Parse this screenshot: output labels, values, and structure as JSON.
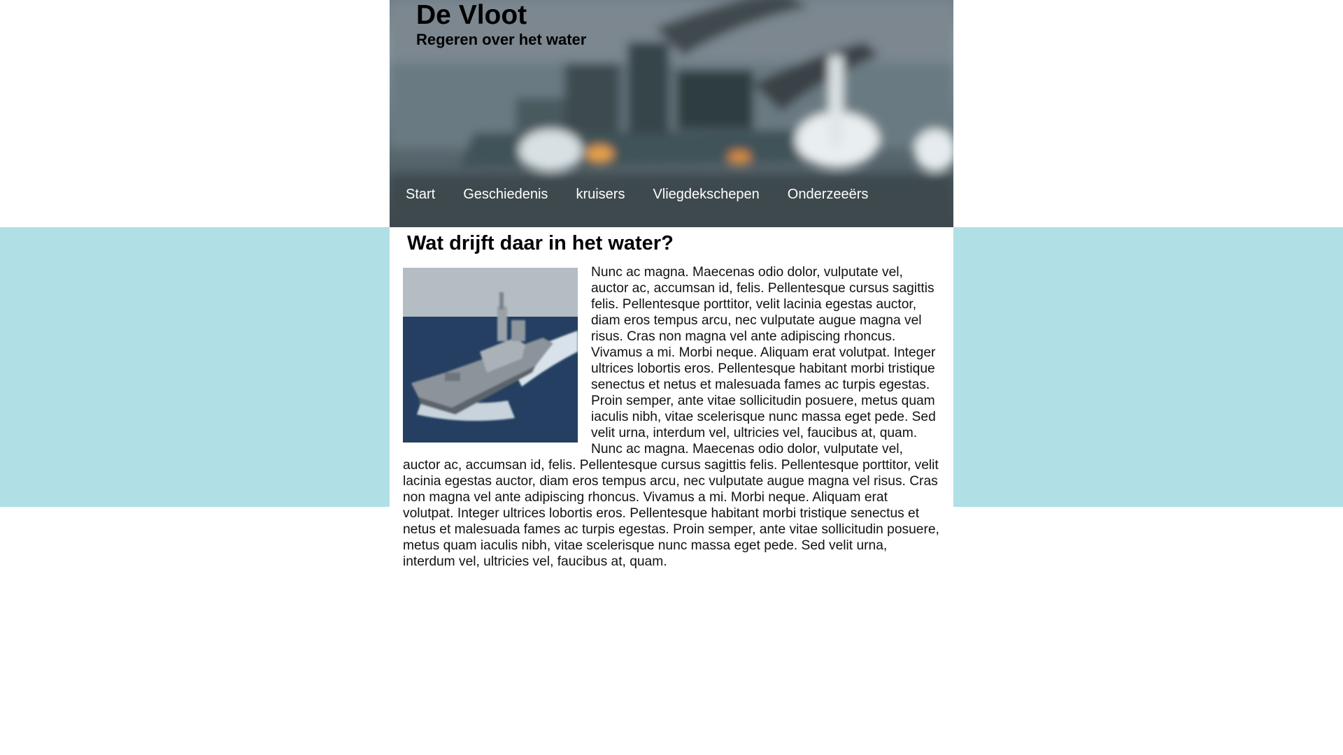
{
  "header": {
    "title": "De Vloot",
    "subtitle": "Regeren over het water"
  },
  "nav": {
    "items": [
      {
        "label": "Start"
      },
      {
        "label": "Geschiedenis"
      },
      {
        "label": "kruisers"
      },
      {
        "label": "Vliegdekschepen"
      },
      {
        "label": "Onderzeeërs"
      }
    ]
  },
  "article": {
    "title": "Wat drijft daar in het water?",
    "image_icon": "warship-photo",
    "body": "Nunc ac magna. Maecenas odio dolor, vulputate vel, auctor ac, accumsan id, felis. Pellentesque cursus sagittis felis. Pellentesque porttitor, velit lacinia egestas auctor, diam eros tempus arcu, nec vulputate augue magna vel risus. Cras non magna vel ante adipiscing rhoncus. Vivamus a mi. Morbi neque. Aliquam erat volutpat. Integer ultrices lobortis eros. Pellentesque habitant morbi tristique senectus et netus et malesuada fames ac turpis egestas. Proin semper, ante vitae sollicitudin posuere, metus quam iaculis nibh, vitae scelerisque nunc massa eget pede. Sed velit urna, interdum vel, ultricies vel, faucibus at, quam. Nunc ac magna. Maecenas odio dolor, vulputate vel, auctor ac, accumsan id, felis. Pellentesque cursus sagittis felis. Pellentesque porttitor, velit lacinia egestas auctor, diam eros tempus arcu, nec vulputate augue magna vel risus. Cras non magna vel ante adipiscing rhoncus. Vivamus a mi. Morbi neque. Aliquam erat volutpat. Integer ultrices lobortis eros. Pellentesque habitant morbi tristique senectus et netus et malesuada fames ac turpis egestas. Proin semper, ante vitae sollicitudin posuere, metus quam iaculis nibh, vitae scelerisque nunc massa eget pede. Sed velit urna, interdum vel, ultricies vel, faucibus at, quam."
  },
  "colors": {
    "band": "#b0dfe5",
    "nav_text": "#ffffff",
    "column": "#ffffff"
  }
}
